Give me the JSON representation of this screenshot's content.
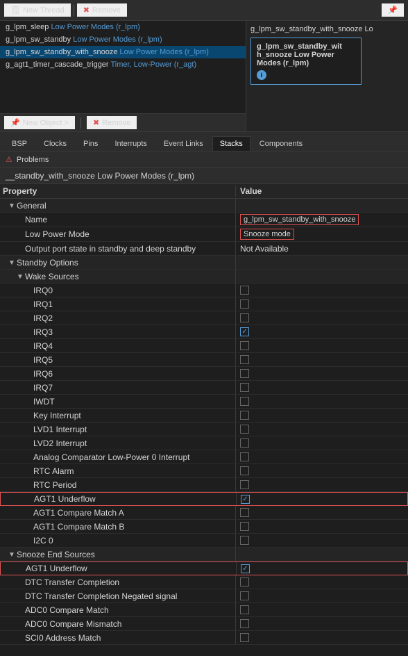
{
  "toolbar": {
    "new_thread_label": "New Thread",
    "remove_label": "Remove"
  },
  "thread_list": {
    "items": [
      {
        "text": "g_lpm_sleep Low Power Modes (r_lpm)",
        "selected": false
      },
      {
        "text": "g_lpm_sw_standby Low Power Modes (r_lpm)",
        "selected": false
      },
      {
        "text": "g_lpm_sw_standby_with_snooze Low Power Modes (r_lpm)",
        "selected": true
      },
      {
        "text": "g_agt1_timer_cascade_trigger Timer, Low-Power (r_agt)",
        "selected": false
      }
    ]
  },
  "object_toolbar": {
    "new_object_label": "New Object >",
    "remove_label": "Remove"
  },
  "component": {
    "title": "g_lpm_sw_standby_with_snooze Lo",
    "box_line1": "g_lpm_sw_standby_wit",
    "box_line2": "h_snooze Low Power",
    "box_line3": "Modes (r_lpm)"
  },
  "tabs": {
    "items": [
      "BSP",
      "Clocks",
      "Pins",
      "Interrupts",
      "Event Links",
      "Stacks",
      "Components"
    ]
  },
  "problems_bar": {
    "label": "Problems"
  },
  "properties_title": "_standby_with_snooze Low Power Modes (r_lpm)",
  "col_headers": {
    "property": "Property",
    "value": "Value"
  },
  "properties": {
    "general": {
      "label": "General",
      "name": {
        "key": "Name",
        "value": "g_lpm_sw_standby_with_snooze",
        "highlighted": true
      },
      "low_power_mode": {
        "key": "Low Power Mode",
        "value": "Snooze mode",
        "highlighted": true
      },
      "output_port": {
        "key": "Output port state in standby and deep standby",
        "value": "Not Available"
      }
    },
    "standby_options": {
      "label": "Standby Options",
      "wake_sources": {
        "label": "Wake Sources",
        "items": [
          {
            "key": "IRQ0",
            "checked": false
          },
          {
            "key": "IRQ1",
            "checked": false
          },
          {
            "key": "IRQ2",
            "checked": false
          },
          {
            "key": "IRQ3",
            "checked": true
          },
          {
            "key": "IRQ4",
            "checked": false
          },
          {
            "key": "IRQ5",
            "checked": false
          },
          {
            "key": "IRQ6",
            "checked": false
          },
          {
            "key": "IRQ7",
            "checked": false
          },
          {
            "key": "IWDT",
            "checked": false
          },
          {
            "key": "Key Interrupt",
            "checked": false
          },
          {
            "key": "LVD1 Interrupt",
            "checked": false
          },
          {
            "key": "LVD2 Interrupt",
            "checked": false
          },
          {
            "key": "Analog Comparator Low-Power 0 Interrupt",
            "checked": false
          },
          {
            "key": "RTC Alarm",
            "checked": false
          },
          {
            "key": "RTC Period",
            "checked": false
          },
          {
            "key": "AGT1 Underflow",
            "checked": true,
            "highlighted": true
          },
          {
            "key": "AGT1 Compare Match A",
            "checked": false
          },
          {
            "key": "AGT1 Compare Match B",
            "checked": false
          },
          {
            "key": "I2C 0",
            "checked": false
          }
        ]
      }
    },
    "snooze_end_sources": {
      "label": "Snooze End Sources",
      "items": [
        {
          "key": "AGT1 Underflow",
          "checked": true,
          "highlighted": true
        },
        {
          "key": "DTC Transfer Completion",
          "checked": false
        },
        {
          "key": "DTC Transfer Completion Negated signal",
          "checked": false
        },
        {
          "key": "ADC0 Compare Match",
          "checked": false
        },
        {
          "key": "ADC0 Compare Mismatch",
          "checked": false
        },
        {
          "key": "SCI0 Address Match",
          "checked": false
        }
      ]
    }
  }
}
